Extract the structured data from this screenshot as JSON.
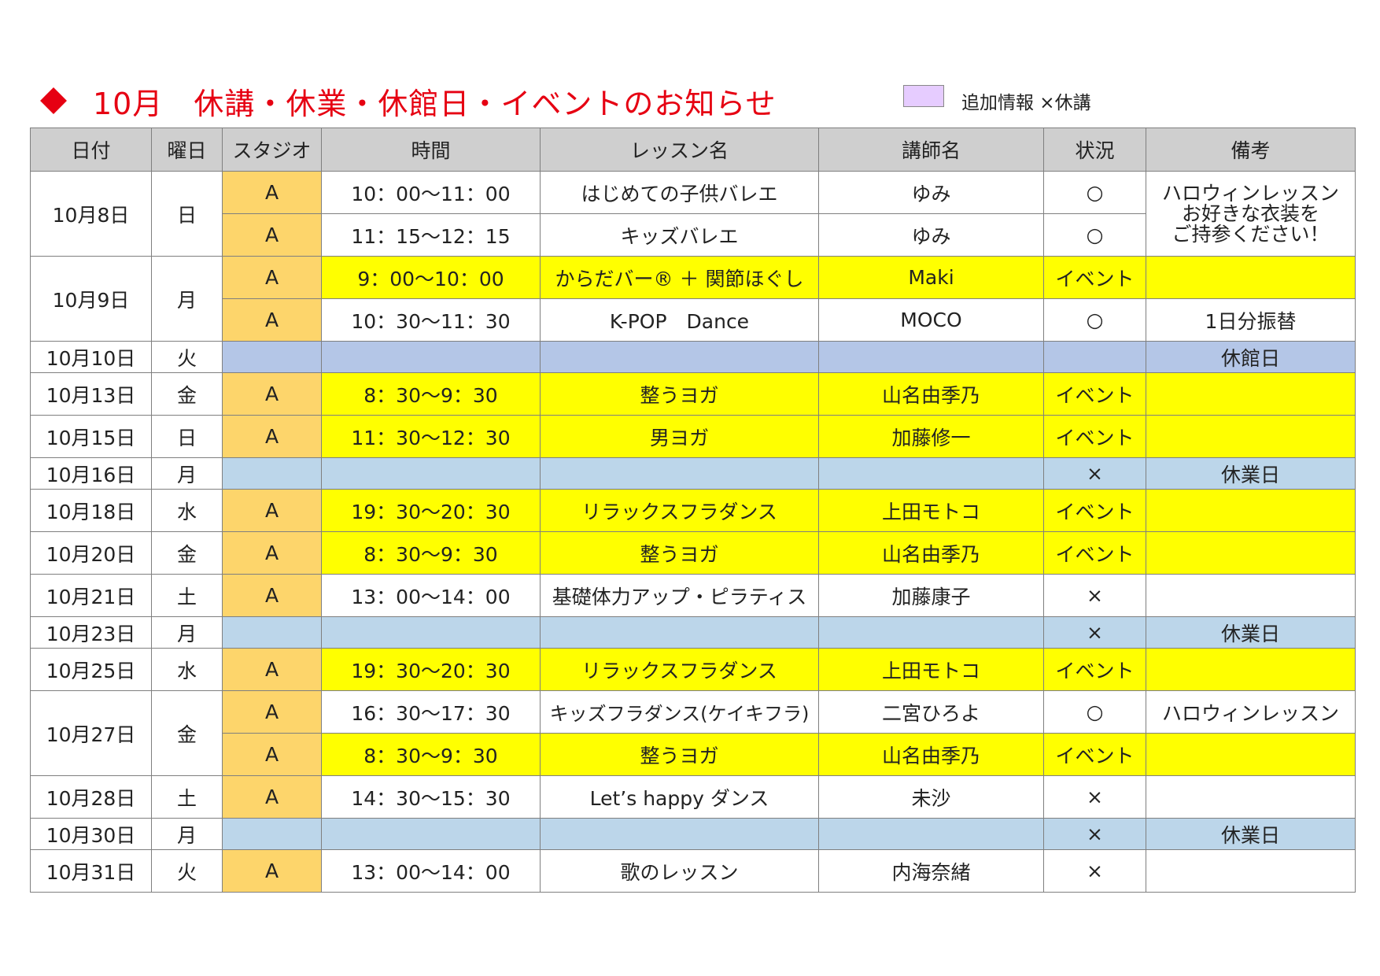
{
  "title": "10月　休講・休業・休館日・イベントのお知らせ",
  "legend": {
    "swatch_color": "#e6ccff",
    "label": "追加情報 ×休講"
  },
  "colors": {
    "title_red": "#e60012",
    "event_yellow": "#ffff00",
    "studio_orange": "#fdd56b",
    "closed_blue": "#bcd6ea",
    "museum_closed_blue": "#b4c6e7",
    "header_gray": "#cfcfcf"
  },
  "headers": [
    "日付",
    "曜日",
    "スタジオ",
    "時間",
    "レッスン名",
    "講師名",
    "状況",
    "備考"
  ],
  "rows": [
    {
      "date": "10月8日",
      "day": "日",
      "studio": "A",
      "time": "10：00～11：00",
      "lesson": "はじめての子供バレエ",
      "teacher": "ゆみ",
      "status": "○",
      "note_lines": [
        "ハロウィンレッスン",
        "お好きな衣装を",
        "ご持参ください！"
      ]
    },
    {
      "studio": "A",
      "time": "11：15～12：15",
      "lesson": "キッズバレエ",
      "teacher": "ゆみ",
      "status": "○"
    },
    {
      "date": "10月9日",
      "day": "月",
      "studio": "A",
      "time": "9：00～10：00",
      "lesson": "からだバー® ＋ 関節ほぐし",
      "teacher": "Maki",
      "status": "イベント",
      "note": ""
    },
    {
      "studio": "A",
      "time": "10：30～11：30",
      "lesson": "K-POP　Dance",
      "teacher": "MOCO",
      "status": "○",
      "note": "1日分振替"
    },
    {
      "date": "10月10日",
      "day": "火",
      "note": "休館日"
    },
    {
      "date": "10月13日",
      "day": "金",
      "studio": "A",
      "time": "8：30～9：30",
      "lesson": "整うヨガ",
      "teacher": "山名由季乃",
      "status": "イベント",
      "note": ""
    },
    {
      "date": "10月15日",
      "day": "日",
      "studio": "A",
      "time": "11：30～12：30",
      "lesson": "男ヨガ",
      "teacher": "加藤修一",
      "status": "イベント",
      "note": ""
    },
    {
      "date": "10月16日",
      "day": "月",
      "status": "×",
      "note": "休業日"
    },
    {
      "date": "10月18日",
      "day": "水",
      "studio": "A",
      "time": "19：30～20：30",
      "lesson": "リラックスフラダンス",
      "teacher": "上田モトコ",
      "status": "イベント",
      "note": ""
    },
    {
      "date": "10月20日",
      "day": "金",
      "studio": "A",
      "time": "8：30～9：30",
      "lesson": "整うヨガ",
      "teacher": "山名由季乃",
      "status": "イベント",
      "note": ""
    },
    {
      "date": "10月21日",
      "day": "土",
      "studio": "A",
      "time": "13：00～14：00",
      "lesson": "基礎体力アップ・ピラティス",
      "teacher": "加藤康子",
      "status": "×",
      "note": ""
    },
    {
      "date": "10月23日",
      "day": "月",
      "status": "×",
      "note": "休業日"
    },
    {
      "date": "10月25日",
      "day": "水",
      "studio": "A",
      "time": "19：30～20：30",
      "lesson": "リラックスフラダンス",
      "teacher": "上田モトコ",
      "status": "イベント",
      "note": ""
    },
    {
      "date": "10月27日",
      "day": "金",
      "studio": "A",
      "time": "16：30～17：30",
      "lesson": "キッズフラダンス(ケイキフラ)",
      "teacher": "二宮ひろよ",
      "status": "○",
      "note": "ハロウィンレッスン"
    },
    {
      "studio": "A",
      "time": "8：30～9：30",
      "lesson": "整うヨガ",
      "teacher": "山名由季乃",
      "status": "イベント",
      "note": ""
    },
    {
      "date": "10月28日",
      "day": "土",
      "studio": "A",
      "time": "14：30～15：30",
      "lesson": "Let’s happy ダンス",
      "teacher": "未沙",
      "status": "×",
      "note": ""
    },
    {
      "date": "10月30日",
      "day": "月",
      "status": "×",
      "note": "休業日"
    },
    {
      "date": "10月31日",
      "day": "火",
      "studio": "A",
      "time": "13：00～14：00",
      "lesson": "歌のレッスン",
      "teacher": "内海奈緒",
      "status": "×",
      "note": ""
    }
  ]
}
